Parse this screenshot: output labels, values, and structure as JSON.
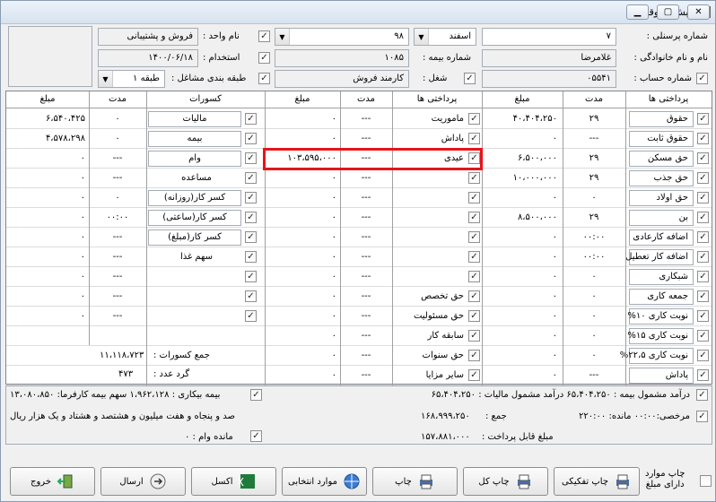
{
  "window": {
    "title": "فیش حقوقی",
    "buttons": [
      "▭",
      "▢",
      "✕"
    ]
  },
  "header": {
    "personnel_no_label": "شماره پرسنلی :",
    "personnel_no": "۷",
    "month": "اسفند",
    "month_combo_right_value": "۹۸",
    "unit_label": "نام واحد :",
    "unit": "فروش و پشتیبانی",
    "name_label": "نام و نام خانوادگی :",
    "name": "غلامرضا",
    "insurance_no_label": "شماره بیمه :",
    "insurance_no": "۱۰۸۵",
    "hire_label": "استخدام :",
    "hire_date": "۱۴۰۰/۰۶/۱۸",
    "account_label": "شماره حساب :",
    "account_no": "۰۵۵۴۱",
    "job_label": "شغل :",
    "job": "کارمند فروش",
    "job_class_label": "طبقه بندی مشاغل :",
    "job_class": "طبقه ۱"
  },
  "grid": {
    "headers": {
      "pay1": "پرداختی ها",
      "dur1": "مدت",
      "amt1": "مبلغ",
      "pay2": "پرداختی ها",
      "dur2": "مدت",
      "amt2": "مبلغ",
      "ded": "کسورات",
      "dur3": "مدت",
      "amt3": "مبلغ"
    },
    "col1": [
      {
        "label": "حقوق",
        "dur": "۲۹",
        "amt": "۴۰،۴۰۴،۲۵۰"
      },
      {
        "label": "حقوق ثابت",
        "dur": "---",
        "amt": "۰"
      },
      {
        "label": "حق مسکن",
        "dur": "۲۹",
        "amt": "۶،۵۰۰،۰۰۰"
      },
      {
        "label": "حق جذب",
        "dur": "۲۹",
        "amt": "۱۰،۰۰۰،۰۰۰"
      },
      {
        "label": "حق اولاد",
        "dur": "۰",
        "amt": "۰"
      },
      {
        "label": "بن",
        "dur": "۲۹",
        "amt": "۸،۵۰۰،۰۰۰"
      },
      {
        "label": "اضافه کارعادی",
        "dur": "۰۰:۰۰",
        "amt": "۰"
      },
      {
        "label": "اضافه کار تعطیل",
        "dur": "۰۰:۰۰",
        "amt": "۰"
      },
      {
        "label": "شبکاری",
        "dur": "۰",
        "amt": "۰"
      },
      {
        "label": "جمعه کاری",
        "dur": "۰",
        "amt": "۰"
      },
      {
        "label": "نوبت کاری ۱۰%",
        "dur": "۰",
        "amt": "۰"
      },
      {
        "label": "نوبت کاری ۱۵%",
        "dur": "۰",
        "amt": "۰"
      },
      {
        "label": "نوبت کاری ۲۲،۵%",
        "dur": "۰",
        "amt": "۰"
      },
      {
        "label": "پاداش",
        "dur": "---",
        "amt": "۰"
      }
    ],
    "col2": [
      {
        "label": "ماموریت",
        "dur": "---",
        "amt": "۰"
      },
      {
        "label": "پاداش",
        "dur": "---",
        "amt": "۰"
      },
      {
        "label": "عیدی",
        "dur": "---",
        "amt": "۱۰۳،۵۹۵،۰۰۰"
      },
      {
        "label": "",
        "dur": "---",
        "amt": "۰"
      },
      {
        "label": "",
        "dur": "---",
        "amt": "۰"
      },
      {
        "label": "",
        "dur": "---",
        "amt": "۰"
      },
      {
        "label": "",
        "dur": "---",
        "amt": "۰"
      },
      {
        "label": "",
        "dur": "---",
        "amt": "۰"
      },
      {
        "label": "",
        "dur": "---",
        "amt": "۰"
      },
      {
        "label": "حق تخصص",
        "dur": "---",
        "amt": "۰"
      },
      {
        "label": "حق مسئولیت",
        "dur": "---",
        "amt": "۰"
      },
      {
        "label": "سابقه کار",
        "dur": "---",
        "amt": "۰"
      },
      {
        "label": "حق سنوات",
        "dur": "---",
        "amt": "۰"
      },
      {
        "label": "سایر مزایا",
        "dur": "---",
        "amt": "۰"
      }
    ],
    "col3": [
      {
        "label": "مالیات",
        "dur": "۰",
        "amt": "۶،۵۴۰،۴۲۵",
        "box": true
      },
      {
        "label": "بیمه",
        "dur": "۰",
        "amt": "۴،۵۷۸،۲۹۸",
        "box": true
      },
      {
        "label": "وام",
        "dur": "---",
        "amt": "۰",
        "box": true
      },
      {
        "label": "مساعده",
        "dur": "---",
        "amt": "۰",
        "box": false
      },
      {
        "label": "کسر کار(روزانه)",
        "dur": "۰",
        "amt": "۰",
        "box": true
      },
      {
        "label": "کسر کار(ساعتی)",
        "dur": "۰۰:۰۰",
        "amt": "۰",
        "box": true
      },
      {
        "label": "کسر کار(مبلغ)",
        "dur": "---",
        "amt": "۰",
        "box": true
      },
      {
        "label": "سهم غذا",
        "dur": "---",
        "amt": "۰",
        "box": false
      },
      {
        "label": "",
        "dur": "---",
        "amt": "۰",
        "box": false
      },
      {
        "label": "",
        "dur": "---",
        "amt": "۰",
        "box": false
      },
      {
        "label": "",
        "dur": "---",
        "amt": "۰",
        "box": false
      }
    ],
    "total_deductions_label": "جمع کسورات :",
    "total_deductions": "۱۱،۱۱۸،۷۲۳",
    "rounding_label": "گرد عدد :",
    "rounding": "۴۷۳"
  },
  "summary": {
    "line1_right": "درآمد مشمول بیمه : ۶۵،۴۰۴،۲۵۰ درآمد مشمول مالیات : ۶۵،۴۰۴،۲۵۰",
    "line1_left": "بیمه بیکاری : ۱،۹۶۲،۱۲۸ سهم بیمه کارفرما: ۱۳،۰۸۰،۸۵۰",
    "leave_text": "مرخصی:۰۰:۰۰ مانده: ۲۲۰:۰۰",
    "sum_label": "جمع :",
    "sum_value": "۱۶۸،۹۹۹،۲۵۰",
    "sum_words": "صد و پنجاه و هفت میلیون و هشتصد و هشتاد و یک هزار ریال",
    "payable_label": "مبلغ قابل پرداخت :",
    "payable_value": "۱۵۷،۸۸۱،۰۰۰",
    "loan_remaining": "مانده وام : ۰"
  },
  "buttons": {
    "print_items_line1": "چاپ موارد",
    "print_items_line2": "دارای مبلغ",
    "print_detail": "چاپ تفکیکی",
    "print_all": "چاپ کل",
    "print": "چاپ",
    "selected": "موارد انتخابی",
    "excel": "اکسل",
    "send": "ارسال",
    "exit": "خروج"
  }
}
